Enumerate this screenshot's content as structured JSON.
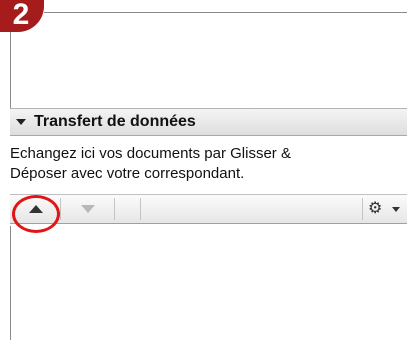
{
  "step_badge": {
    "number": "2",
    "color": "#a61c1c"
  },
  "panel": {
    "title": "Transfert de données",
    "description_line1": "Echangez ici vos documents par Glisser &",
    "description_line2": "Déposer avec votre correspondant.",
    "toolbar": {
      "upload_icon": "arrow-up-icon",
      "download_icon": "arrow-down-icon",
      "settings_icon": "gear-icon"
    }
  },
  "annotation": {
    "highlight_color": "#e01515",
    "target": "upload-button"
  }
}
